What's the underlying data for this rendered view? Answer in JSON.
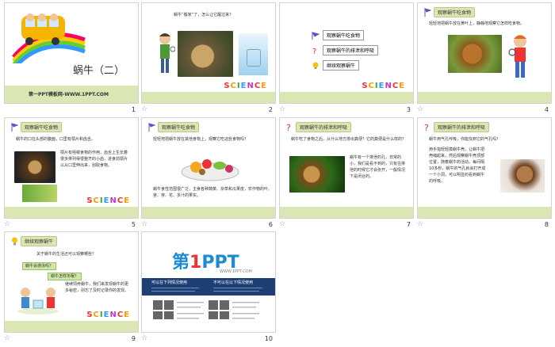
{
  "slides": [
    {
      "num": "1",
      "title": "蜗牛（二）",
      "footer": "第一PPT模板网-WWW.1PPT.COM"
    },
    {
      "num": "2",
      "text": "蜗牛“搬家”了，怎么让它醒过来？"
    },
    {
      "num": "3",
      "menu": [
        "观察蜗牛吃食物",
        "观察蜗牛的排泄和呼吸",
        "继续观察蜗牛"
      ]
    },
    {
      "num": "4",
      "header": "观察蜗牛吃食物",
      "text": "轻轻地把蜗牛放在黄叶上，静静地观察它怎样吃食物。"
    },
    {
      "num": "5",
      "header": "观察蜗牛吃食物",
      "text1": "蜗牛的口在头部的腹面，口里有颚片和齿舌。",
      "text2": "颚片有咀嚼食物的作用，齿舌上生长着很多排列得很整齐的小齿，进食前颚片以从口里伸出来，刮取食物。"
    },
    {
      "num": "6",
      "header": "观察蜗牛吃食物",
      "text1": "轻轻地把蜗牛放在其他食物上，观察它吃这些食物吗？",
      "text2": "蜗牛食性范围很广泛，主食各种蔬菜、杂草和瓜果皮，农作物的叶、茎、芽、花、多汁的果实。"
    },
    {
      "num": "7",
      "header": "观察蜗牛的排泄和呼吸",
      "text1": "蜗牛吃了食物之后，从什么地方排出粪便？它的粪便是什么样的？",
      "text2": "蜗牛有一个排泄的孔，非常的小，我们是看不到的，只有在排泄的时候它才会张开，一般情况下是闭合的。"
    },
    {
      "num": "8",
      "header": "观察蜗牛的排泄和呼吸",
      "text1": "蜗牛用气孔呼吸，你能找到它的气孔吗？",
      "text2": "用手指轻轻摸蜗牛壳，让蜗牛把壳缩起来，然后观察蜗牛壳顶部位置，随着蜗牛的活动，每间隔10多秒，蜗牛的气孔就会打开成一个小洞，可以明显的看到蜗牛的呼吸。"
    },
    {
      "num": "9",
      "header": "继续观察蜗牛",
      "text1": "关于蜗牛的生活还可以观察哪些？",
      "bubble1": "蜗牛会游泳吗？",
      "bubble2": "蜗牛怎样冬眠？",
      "text2": "继续饲养蜗牛，我们来发现蜗牛的更多秘密，别忘了及时记录你的发现。"
    },
    {
      "num": "10",
      "logo_a": "第",
      "logo_b": "1",
      "logo_c": "PPT",
      "url": "WWW.1PPT.COM",
      "col1": "可以在下列情况使用",
      "col2": "不可以在以下情况使用"
    }
  ],
  "science_word": "SCIENCE",
  "star_glyph": "☆"
}
